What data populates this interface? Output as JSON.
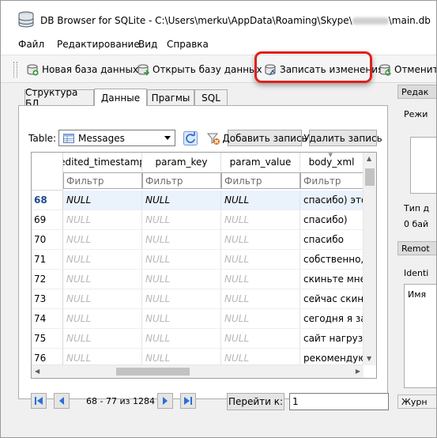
{
  "window": {
    "title": "DB Browser for SQLite - C:\\Users\\merku\\AppData\\Roaming\\Skype\\",
    "title_suffix": "\\main.db"
  },
  "menu": [
    "Файл",
    "Редактирование",
    "Вид",
    "Справка"
  ],
  "toolbar": {
    "new_db": "Новая база данных",
    "open_db": "Открыть базу данных",
    "write_changes": "Записать изменения",
    "revert": "Отменит"
  },
  "tabs": [
    "Структура БД",
    "Данные",
    "Прагмы",
    "SQL"
  ],
  "browse": {
    "table_label": "Table:",
    "table_value": "Messages",
    "add_record": "Добавить запись",
    "delete_record": "Удалить запись"
  },
  "grid": {
    "columns": [
      "edited_timestamp",
      "param_key",
      "param_value",
      "body_xml"
    ],
    "filter_placeholder": "Фильтр",
    "rows": [
      {
        "n": "68",
        "a": "NULL",
        "b": "NULL",
        "c": "NULL",
        "d": "спасибо) это,",
        "current": true
      },
      {
        "n": "69",
        "a": "NULL",
        "b": "NULL",
        "c": "NULL",
        "d": "спасибо)"
      },
      {
        "n": "70",
        "a": "NULL",
        "b": "NULL",
        "c": "NULL",
        "d": "спасибо"
      },
      {
        "n": "71",
        "a": "NULL",
        "b": "NULL",
        "c": "NULL",
        "d": "собственно, к"
      },
      {
        "n": "72",
        "a": "NULL",
        "b": "NULL",
        "c": "NULL",
        "d": "скиньте мне ."
      },
      {
        "n": "73",
        "a": "NULL",
        "b": "NULL",
        "c": "NULL",
        "d": "сейчас скину"
      },
      {
        "n": "74",
        "a": "NULL",
        "b": "NULL",
        "c": "NULL",
        "d": "сегодня я зак"
      },
      {
        "n": "75",
        "a": "NULL",
        "b": "NULL",
        "c": "NULL",
        "d": "сайт нагрузку"
      },
      {
        "n": "76",
        "a": "NULL",
        "b": "NULL",
        "c": "NULL",
        "d": "рекомендую ."
      }
    ]
  },
  "pager": {
    "info": "68 - 77 из 1284",
    "goto_label": "Перейти к:",
    "goto_value": "1"
  },
  "right_dock": {
    "edit_title": "Редак",
    "mode_label": "Режи",
    "type_label": "Тип д",
    "size_label": "0 бай",
    "remote_title": "Remot",
    "identity_label": "Identi",
    "name_label": "Имя",
    "bottom_tab": "Журн"
  },
  "colors": {
    "highlight": "#e0201b",
    "current_row": "#eaf2fb",
    "nav_blue": "#2a6fd6"
  }
}
